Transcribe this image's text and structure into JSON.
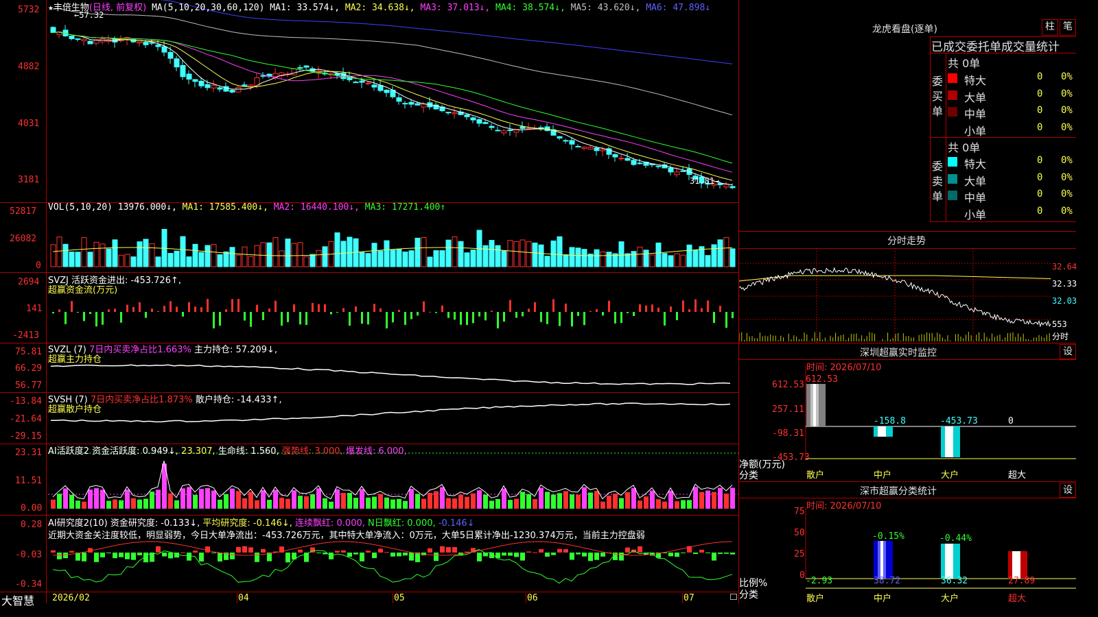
{
  "stock": {
    "star": "★",
    "name": "丰倍生物",
    "mode": "(日线, 前复权)",
    "ma_params": "MA(5,10,20,30,60,120)",
    "ma1": "MA1: 33.574↓,",
    "ma2": "MA2: 34.638↓,",
    "ma3": "MA3: 37.013↓,",
    "ma4": "MA4: 38.574↓,",
    "ma5": "MA5: 43.620↓,",
    "ma6": "MA6: 47.898↓",
    "high_mark": "57.32",
    "low_mark": "31.81",
    "price_ticks": [
      "5732",
      "4882",
      "4031",
      "3181"
    ]
  },
  "vol": {
    "label": "VOL(5,10,20)",
    "value": "13976.000↓,",
    "ma1": "MA1: 17585.400↓,",
    "ma2": "MA2: 16440.100↓,",
    "ma3": "MA3: 17271.400↑",
    "ticks": [
      "52817",
      "26082",
      "0"
    ]
  },
  "svzj": {
    "label": "SVZJ  活跃资金进出: -453.726↑,",
    "sub": "超赢资金流(万元)",
    "ticks": [
      "2694",
      "141",
      "-2413"
    ]
  },
  "svzl": {
    "label": "SVZL (7)",
    "ratio": "7日内买卖净占比1.663%",
    "hold": "主力持仓: 57.209↓,",
    "sub": "超赢主力持仓",
    "ticks": [
      "75.81",
      "66.29",
      "56.77"
    ]
  },
  "svsh": {
    "label": "SVSH (7)",
    "ratio": "7日内买卖净占比1.873%",
    "hold": "散户持仓: -14.433↑,",
    "sub": "超赢散户持仓",
    "ticks": [
      "-13.84",
      "-21.64",
      "-29.15"
    ]
  },
  "ai_active": {
    "label": "AI活跃度2",
    "v1": "资金活跃度: 0.949↓,",
    "v2": "23.307,",
    "v3": "生命线: 1.560,",
    "v4": "强势线: 3.000,",
    "v5": "爆发线: 6.000,",
    "ticks": [
      "23.31",
      "11.51",
      "0.00"
    ]
  },
  "ai_research": {
    "label": "AI研究度2(10)",
    "v1": "资金研究度: -0.133↓,",
    "v2": "平均研究度: -0.146↓,",
    "v3": "连续飘红: 0.000,",
    "v4": "N日飘红: 0.000,",
    "v5": "-0.146↓",
    "comment": "近期大资金关注度较低，明显弱势，今日大单净流出：-453.726万元，其中特大单净流入：0万元，大单5日累计净出-1230.374万元，当前主力控盘弱",
    "ticks": [
      "0.28",
      "-0.03",
      "-0.34"
    ]
  },
  "bottom": {
    "brand": "大智慧",
    "dates": [
      "2026/02",
      "04",
      "05",
      "06",
      "07"
    ]
  },
  "right": {
    "dragon_title": "龙虎看盘(逐单)",
    "btn_zhu": "柱",
    "btn_bi": "笔",
    "tabs": "已成交委托单成交量统计",
    "buy_side": "委买单",
    "sell_side": "委卖单",
    "buy_total": "共 0单",
    "sell_total": "共 0单",
    "buy_rows": [
      {
        "name": "特大",
        "qty": "0",
        "pct": "0%",
        "color": "#ff0000"
      },
      {
        "name": "大单",
        "qty": "0",
        "pct": "0%",
        "color": "#aa0000"
      },
      {
        "name": "中单",
        "qty": "0",
        "pct": "0%",
        "color": "#700000"
      },
      {
        "name": "小单",
        "qty": "0",
        "pct": "0%",
        "color": "#000000"
      }
    ],
    "sell_rows": [
      {
        "name": "特大",
        "qty": "0",
        "pct": "0%",
        "color": "#00ffff"
      },
      {
        "name": "大单",
        "qty": "0",
        "pct": "0%",
        "color": "#009090"
      },
      {
        "name": "中单",
        "qty": "0",
        "pct": "0%",
        "color": "#006a6a"
      },
      {
        "name": "小单",
        "qty": "0",
        "pct": "0%",
        "color": "#000000"
      }
    ],
    "intraday_title": "分时走势",
    "intraday_ticks": [
      "32.64",
      "32.33",
      "32.03"
    ],
    "intraday_vol": "553",
    "intraday_vol_unit": "分时",
    "monitor_title": "深圳超赢实时监控",
    "monitor_time": "时间: 2026/07/10",
    "monitor_ticks": [
      "612.53",
      "257.11",
      "-98.31",
      "-453.73"
    ],
    "monitor_ylabel": "净额(万元)",
    "monitor_xlabel": "分类",
    "monitor_values": [
      "612.53",
      "-158.8",
      "-453.73",
      "0"
    ],
    "categories": [
      "散户",
      "中户",
      "大户",
      "超大"
    ],
    "settings_label": "设",
    "stats_title": "深市超赢分类统计",
    "stats_time": "时间: 2026/07/10",
    "stats_ticks": [
      "75",
      "50",
      "25",
      "0"
    ],
    "stats_ylabel": "比例%",
    "stats_xlabel": "分类",
    "stats_top": [
      "",
      "-0.15%",
      "-0.44%",
      ""
    ],
    "stats_values": [
      "-2.93",
      "38.72",
      "36.32",
      "27.89"
    ]
  },
  "colors": {
    "up": "#ff3030",
    "down": "#40ffff",
    "grid": "#b00000",
    "ma1": "#ffffff",
    "ma2": "#ffff50",
    "ma3": "#ff40ff",
    "ma4": "#30ff30",
    "ma5": "#c0c0c0",
    "ma6": "#4040ff"
  }
}
